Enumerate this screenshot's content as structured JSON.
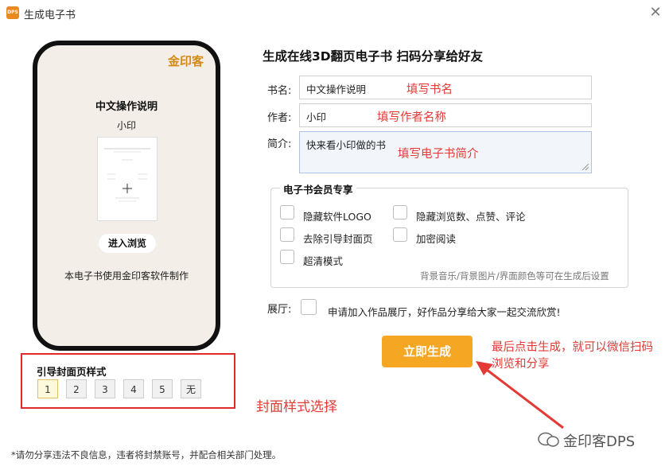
{
  "window": {
    "app_icon_text": "DPS",
    "title": "生成电子书",
    "close_icon": "close-icon"
  },
  "preview": {
    "brand_logo": "金印客",
    "book_title": "中文操作说明",
    "book_author": "小印",
    "enter_button": "进入浏览",
    "made_with": "本电子书使用金印客软件制作"
  },
  "cover_style": {
    "label": "引导封面页样式",
    "options": [
      "1",
      "2",
      "3",
      "4",
      "5",
      "无"
    ],
    "selected": "1",
    "annotation": "封面样式选择"
  },
  "form": {
    "heading": "生成在线3D翻页电子书 扫码分享给好友",
    "name_label": "书名:",
    "name_value": "中文操作说明",
    "name_hint": "填写书名",
    "author_label": "作者:",
    "author_value": "小印",
    "author_hint": "填写作者名称",
    "intro_label": "简介:",
    "intro_value": "快来看小印做的书",
    "intro_hint": "填写电子书简介"
  },
  "member": {
    "title": "电子书会员专享",
    "options": [
      "隐藏软件LOGO",
      "隐藏浏览数、点赞、评论",
      "去除引导封面页",
      "加密阅读",
      "超清模式"
    ],
    "note": "背景音乐/背景图片/界面颜色等可在生成后设置"
  },
  "gallery": {
    "label": "展厅:",
    "text": "申请加入作品展厅，好作品分享给大家一起交流欣赏!"
  },
  "generate": {
    "button": "立即生成",
    "annotation": "最后点击生成，就可以微信扫码浏览和分享"
  },
  "watermark": "金印客DPS",
  "footer": "*请勿分享违法不良信息，违者将封禁账号，并配合相关部门处理。",
  "colors": {
    "accent_orange": "#f5a623",
    "annotation_red": "#e33a35",
    "brand_gold": "#d68a16"
  }
}
